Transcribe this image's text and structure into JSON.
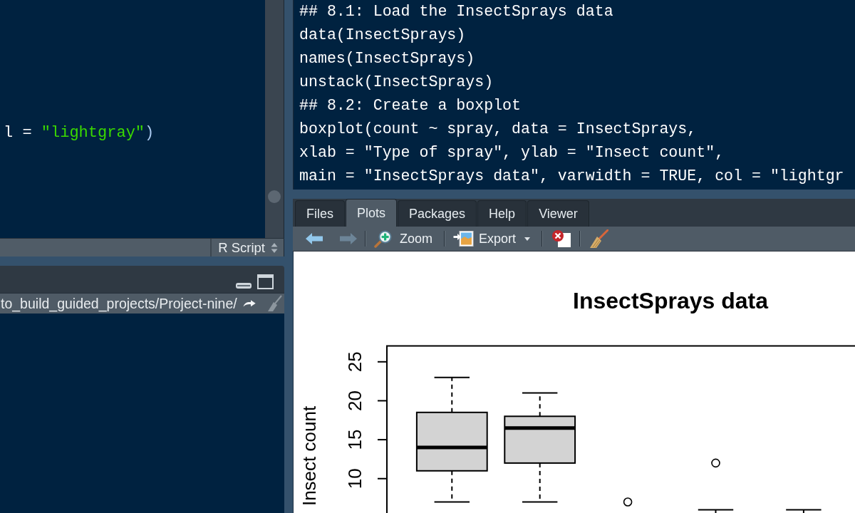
{
  "editor": {
    "lines": [
      {
        "segments": [
          {
            "kind": "plain",
            "text": "l = "
          },
          {
            "kind": "string",
            "text": "\"lightgray\""
          },
          {
            "kind": "bracket",
            "text": ")"
          }
        ]
      }
    ],
    "file_type": "R Script"
  },
  "console": {
    "working_directory": "to_build_guided_projects/Project-nine/"
  },
  "code_pane": {
    "lines": [
      "## 8.1: Load the InsectSprays data",
      "data(InsectSprays)",
      "names(InsectSprays)",
      "unstack(InsectSprays)",
      "## 8.2: Create a boxplot",
      "boxplot(count ~ spray, data = InsectSprays,",
      "xlab = \"Type of spray\", ylab = \"Insect count\",",
      "main = \"InsectSprays data\", varwidth = TRUE, col = \"lightgr"
    ]
  },
  "plots_pane": {
    "tabs": [
      {
        "label": "Files",
        "selected": false
      },
      {
        "label": "Plots",
        "selected": true
      },
      {
        "label": "Packages",
        "selected": false
      },
      {
        "label": "Help",
        "selected": false
      },
      {
        "label": "Viewer",
        "selected": false
      }
    ],
    "toolbar": {
      "back": {
        "disabled": false
      },
      "forward": {
        "disabled": true
      },
      "zoom": {
        "label": "Zoom"
      },
      "export": {
        "label": "Export"
      }
    },
    "plot": {
      "title": "InsectSprays data",
      "ylabel": "Insect count",
      "ytick_labels": [
        "25",
        "20",
        "15",
        "10"
      ]
    }
  }
}
